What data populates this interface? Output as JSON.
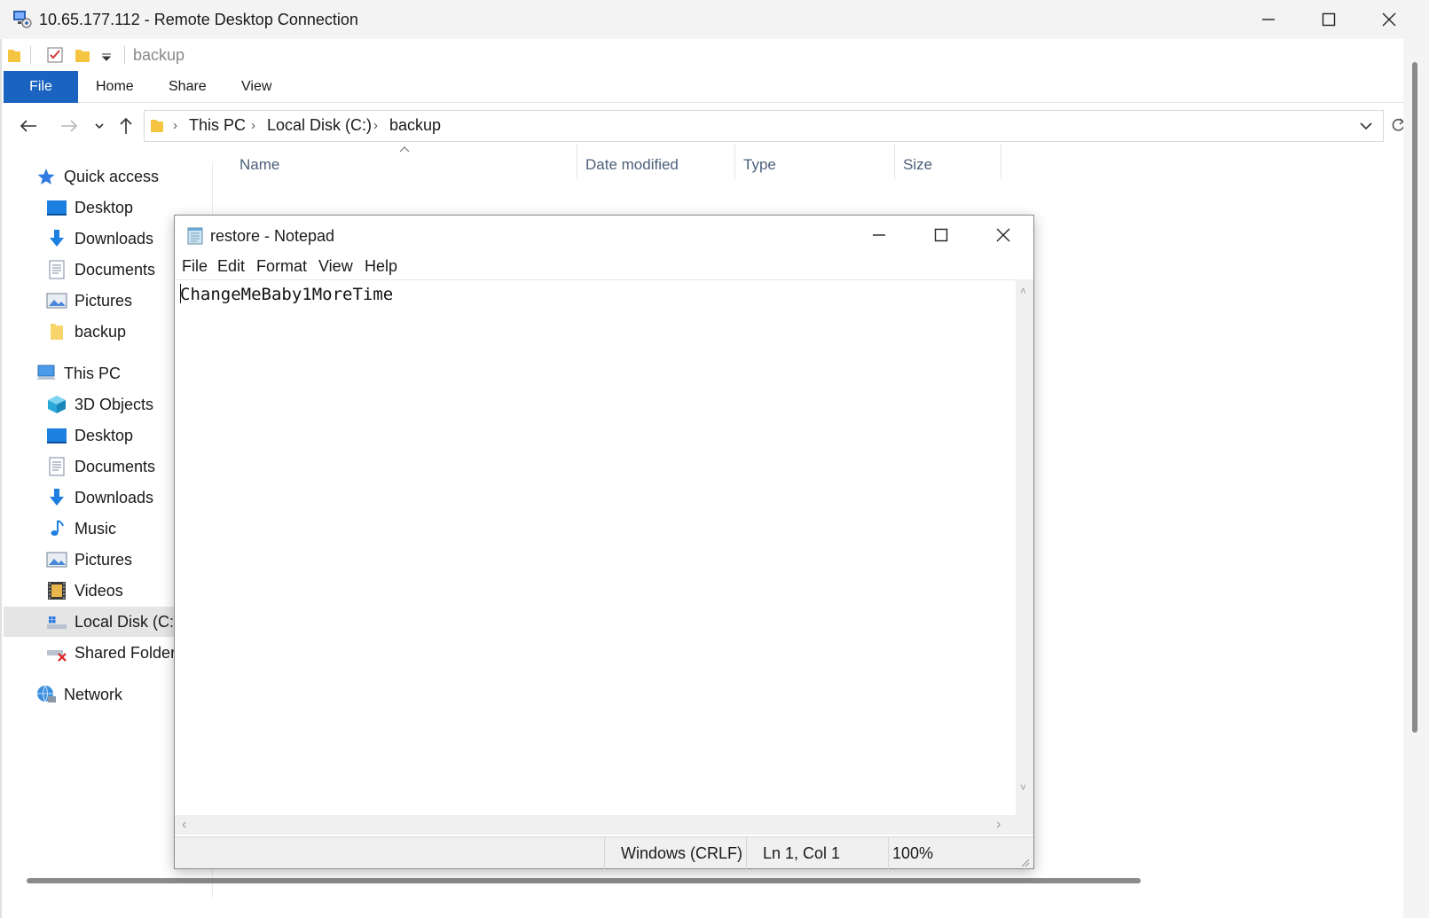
{
  "rdp": {
    "title": "10.65.177.112 - Remote Desktop Connection"
  },
  "explorer": {
    "qat_title": "backup",
    "tabs": [
      "File",
      "Home",
      "Share",
      "View"
    ],
    "breadcrumb": [
      "This PC",
      "Local Disk (C:)",
      "backup"
    ],
    "columns": [
      "Name",
      "Date modified",
      "Type",
      "Size"
    ],
    "nav": {
      "quick_access": "Quick access",
      "quick_items": [
        "Desktop",
        "Downloads",
        "Documents",
        "Pictures",
        "backup"
      ],
      "this_pc": "This PC",
      "pc_items": [
        "3D Objects",
        "Desktop",
        "Documents",
        "Downloads",
        "Music",
        "Pictures",
        "Videos",
        "Local Disk (C:)",
        "Shared Folders"
      ],
      "network": "Network"
    }
  },
  "notepad": {
    "title": "restore - Notepad",
    "menu": [
      "File",
      "Edit",
      "Format",
      "View",
      "Help"
    ],
    "content": "ChangeMeBaby1MoreTime",
    "status": {
      "line_ending": "Windows (CRLF)",
      "position": "Ln 1, Col 1",
      "zoom": "100%"
    }
  }
}
